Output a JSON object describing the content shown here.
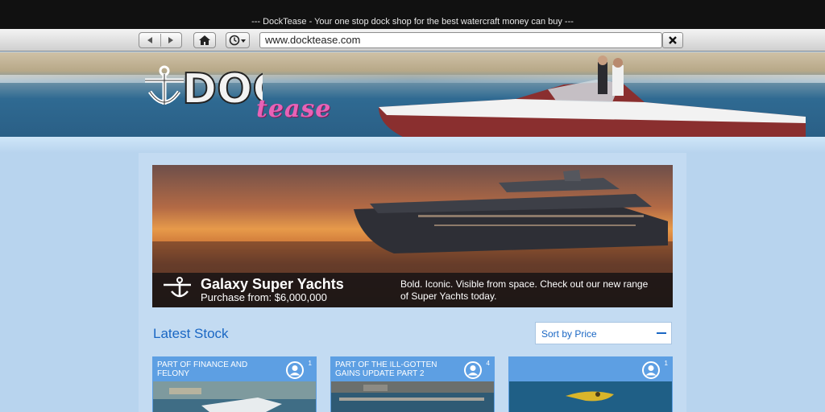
{
  "window": {
    "title": "--- DockTease - Your one stop dock shop for the best watercraft money can buy ---"
  },
  "toolbar": {
    "url": "www.docktease.com",
    "icons": [
      "back-arrow-icon",
      "forward-arrow-icon",
      "home-icon",
      "history-clock-icon",
      "close-x-icon"
    ]
  },
  "site": {
    "logo_main": "DOCK",
    "logo_sub": "tease"
  },
  "hero": {
    "title": "Galaxy Super Yachts",
    "price": "Purchase from: $6,000,000",
    "description": "Bold. Iconic. Visible from space. Check out our new range of Super Yachts today."
  },
  "latest": {
    "heading": "Latest Stock",
    "sort_label": "Sort by Price"
  },
  "cards": [
    {
      "label": "PART OF FINANCE AND FELONY",
      "count": "1"
    },
    {
      "label": "PART OF THE ILL-GOTTEN GAINS UPDATE PART 2",
      "count": "4"
    },
    {
      "label": "",
      "count": "1"
    }
  ],
  "colors": {
    "accent": "#1a67c4",
    "card_header": "#5d9fe3",
    "page_bg": "#b8d4ee",
    "logo_pink": "#e862b6"
  }
}
